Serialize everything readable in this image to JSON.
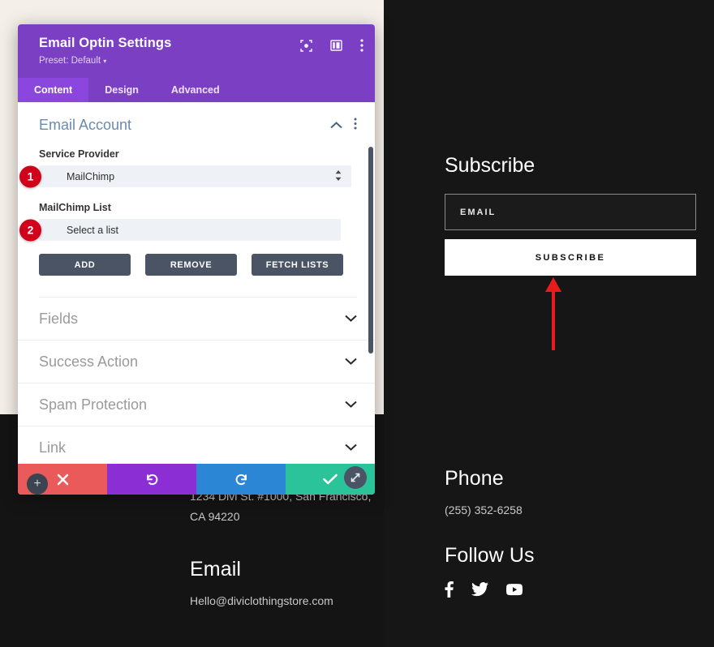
{
  "website": {
    "address_text": "1234 Divi St. #1000, San Francisco, CA 94220",
    "email_heading": "Email",
    "email_text": "Hello@diviclothingstore.com",
    "subscribe_heading": "Subscribe",
    "email_input_placeholder": "EMAIL",
    "subscribe_button_label": "SUBSCRIBE",
    "phone_heading": "Phone",
    "phone_number": "(255) 352-6258",
    "follow_heading": "Follow Us",
    "social_icons": [
      "facebook-icon",
      "twitter-icon",
      "youtube-icon"
    ],
    "annotation_arrow_color": "#e81c1c"
  },
  "modal": {
    "title": "Email Optin Settings",
    "preset_label": "Preset: Default",
    "preset_caret": "▾",
    "header_icons": [
      "focus-target-icon",
      "layout-panel-icon",
      "kebab-menu-icon"
    ],
    "tabs": [
      {
        "label": "Content",
        "active": true
      },
      {
        "label": "Design",
        "active": false
      },
      {
        "label": "Advanced",
        "active": false
      }
    ],
    "accent_color": "#7b3fc4",
    "tab_active_color": "#8b46dd",
    "open_section": {
      "title": "Email Account",
      "collapse_icon": "chevron-up-icon",
      "menu_icon": "kebab-menu-icon",
      "fields": [
        {
          "label": "Service Provider",
          "value": "MailChimp",
          "badge": "1",
          "control": "select"
        },
        {
          "label": "MailChimp List",
          "value": "Select a list",
          "badge": "2",
          "control": "select"
        }
      ],
      "buttons": [
        {
          "label": "ADD"
        },
        {
          "label": "REMOVE"
        },
        {
          "label": "FETCH LISTS"
        }
      ]
    },
    "closed_sections": [
      {
        "title": "Fields"
      },
      {
        "title": "Success Action"
      },
      {
        "title": "Spam Protection"
      },
      {
        "title": "Link"
      }
    ],
    "footer_actions": [
      {
        "name": "cancel",
        "icon": "close-x-icon",
        "color": "#ea5a5a"
      },
      {
        "name": "undo",
        "icon": "undo-arrow-icon",
        "color": "#8b2fd4"
      },
      {
        "name": "redo",
        "icon": "redo-arrow-icon",
        "color": "#2b87d5"
      },
      {
        "name": "save",
        "icon": "checkmark-icon",
        "color": "#2bc49a"
      }
    ],
    "resize_handle_icon": "resize-diagonal-icon",
    "add_module_icon": "plus-icon"
  }
}
